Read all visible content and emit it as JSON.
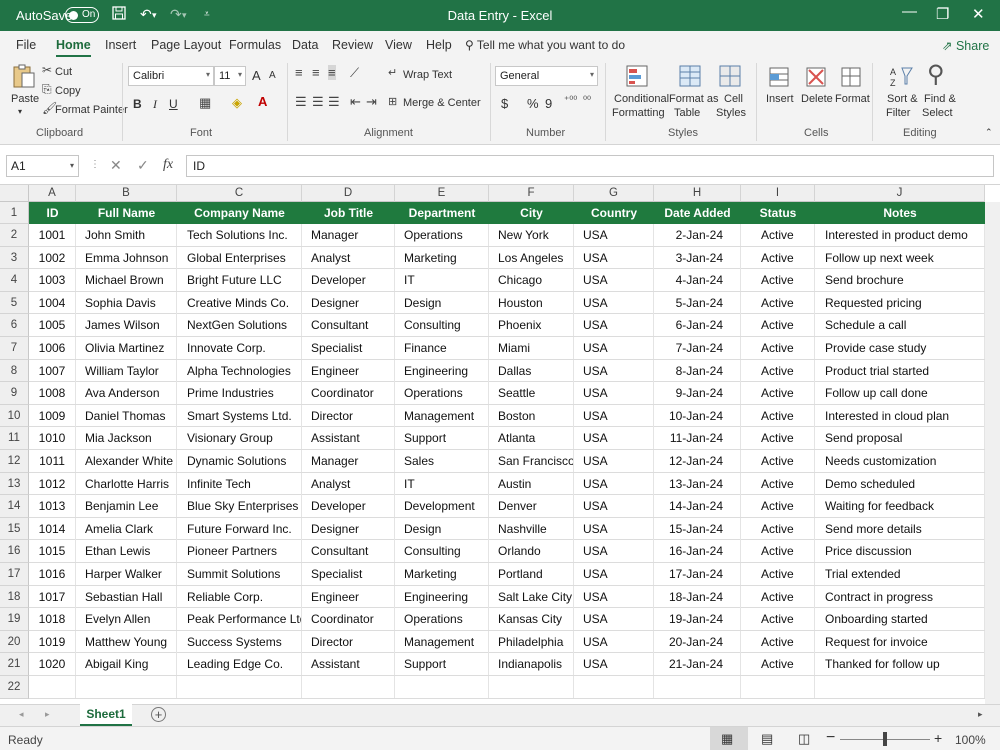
{
  "titlebar": {
    "autosave_label": "AutoSave",
    "autosave_state": "On",
    "title": "Data Entry  -  Excel"
  },
  "tabs": [
    "File",
    "Home",
    "Insert",
    "Page Layout",
    "Formulas",
    "Data",
    "Review",
    "View",
    "Help"
  ],
  "active_tab": "Home",
  "tell_me": "Tell me what you want to do",
  "share": "Share",
  "ribbon": {
    "clipboard": {
      "paste": "Paste",
      "cut": "Cut",
      "copy": "Copy",
      "format_painter": "Format Painter",
      "label": "Clipboard"
    },
    "font": {
      "name": "Calibri",
      "size": "11",
      "grow": "A",
      "shrink": "A",
      "bold": "B",
      "italic": "I",
      "underline": "U",
      "label": "Font"
    },
    "alignment": {
      "wrap_text": "Wrap Text",
      "merge_center": "Merge & Center",
      "label": "Alignment"
    },
    "number": {
      "format": "General",
      "currency": "$",
      "percent": "%",
      "comma": "9",
      "label": "Number"
    },
    "styles": {
      "conditional": "Conditional",
      "conditional2": "Formatting",
      "format_as": "Format as",
      "table": "Table",
      "cell": "Cell",
      "cell_styles": "Styles",
      "label": "Styles"
    },
    "cells": {
      "insert": "Insert",
      "delete": "Delete",
      "format": "Format",
      "label": "Cells"
    },
    "editing": {
      "sort": "Sort &",
      "filter": "Filter",
      "find": "Find &",
      "select": "Select",
      "label": "Editing"
    }
  },
  "formula_bar": {
    "name_box": "A1",
    "fx": "fx",
    "content": "ID"
  },
  "columns": [
    "A",
    "B",
    "C",
    "D",
    "E",
    "F",
    "G",
    "H",
    "I",
    "J"
  ],
  "headers": [
    "ID",
    "Full Name",
    "Company Name",
    "Job Title",
    "Department",
    "City",
    "Country",
    "Date Added",
    "Status",
    "Notes"
  ],
  "rows": [
    [
      "1001",
      "John Smith",
      "Tech Solutions Inc.",
      "Manager",
      "Operations",
      "New York",
      "USA",
      "2-Jan-24",
      "Active",
      "Interested in product demo"
    ],
    [
      "1002",
      "Emma Johnson",
      "Global Enterprises",
      "Analyst",
      "Marketing",
      "Los Angeles",
      "USA",
      "3-Jan-24",
      "Active",
      "Follow up next week"
    ],
    [
      "1003",
      "Michael Brown",
      "Bright Future LLC",
      "Developer",
      "IT",
      "Chicago",
      "USA",
      "4-Jan-24",
      "Active",
      "Send brochure"
    ],
    [
      "1004",
      "Sophia Davis",
      "Creative Minds Co.",
      "Designer",
      "Design",
      "Houston",
      "USA",
      "5-Jan-24",
      "Active",
      "Requested pricing"
    ],
    [
      "1005",
      "James Wilson",
      "NextGen Solutions",
      "Consultant",
      "Consulting",
      "Phoenix",
      "USA",
      "6-Jan-24",
      "Active",
      "Schedule a call"
    ],
    [
      "1006",
      "Olivia Martinez",
      "Innovate Corp.",
      "Specialist",
      "Finance",
      "Miami",
      "USA",
      "7-Jan-24",
      "Active",
      "Provide case study"
    ],
    [
      "1007",
      "William Taylor",
      "Alpha Technologies",
      "Engineer",
      "Engineering",
      "Dallas",
      "USA",
      "8-Jan-24",
      "Active",
      "Product trial started"
    ],
    [
      "1008",
      "Ava Anderson",
      "Prime Industries",
      "Coordinator",
      "Operations",
      "Seattle",
      "USA",
      "9-Jan-24",
      "Active",
      "Follow up call done"
    ],
    [
      "1009",
      "Daniel Thomas",
      "Smart Systems Ltd.",
      "Director",
      "Management",
      "Boston",
      "USA",
      "10-Jan-24",
      "Active",
      "Interested in cloud plan"
    ],
    [
      "1010",
      "Mia Jackson",
      "Visionary Group",
      "Assistant",
      "Support",
      "Atlanta",
      "USA",
      "11-Jan-24",
      "Active",
      "Send proposal"
    ],
    [
      "1011",
      "Alexander White",
      "Dynamic Solutions",
      "Manager",
      "Sales",
      "San Francisco",
      "USA",
      "12-Jan-24",
      "Active",
      "Needs customization"
    ],
    [
      "1012",
      "Charlotte Harris",
      "Infinite Tech",
      "Analyst",
      "IT",
      "Austin",
      "USA",
      "13-Jan-24",
      "Active",
      "Demo scheduled"
    ],
    [
      "1013",
      "Benjamin Lee",
      "Blue Sky Enterprises",
      "Developer",
      "Development",
      "Denver",
      "USA",
      "14-Jan-24",
      "Active",
      "Waiting for feedback"
    ],
    [
      "1014",
      "Amelia Clark",
      "Future Forward Inc.",
      "Designer",
      "Design",
      "Nashville",
      "USA",
      "15-Jan-24",
      "Active",
      "Send more details"
    ],
    [
      "1015",
      "Ethan Lewis",
      "Pioneer Partners",
      "Consultant",
      "Consulting",
      "Orlando",
      "USA",
      "16-Jan-24",
      "Active",
      "Price discussion"
    ],
    [
      "1016",
      "Harper Walker",
      "Summit Solutions",
      "Specialist",
      "Marketing",
      "Portland",
      "USA",
      "17-Jan-24",
      "Active",
      "Trial extended"
    ],
    [
      "1017",
      "Sebastian Hall",
      "Reliable Corp.",
      "Engineer",
      "Engineering",
      "Salt Lake City",
      "USA",
      "18-Jan-24",
      "Active",
      "Contract in progress"
    ],
    [
      "1018",
      "Evelyn Allen",
      "Peak Performance Ltd.",
      "Coordinator",
      "Operations",
      "Kansas City",
      "USA",
      "19-Jan-24",
      "Active",
      "Onboarding started"
    ],
    [
      "1019",
      "Matthew Young",
      "Success Systems",
      "Director",
      "Management",
      "Philadelphia",
      "USA",
      "20-Jan-24",
      "Active",
      "Request for invoice"
    ],
    [
      "1020",
      "Abigail King",
      "Leading Edge Co.",
      "Assistant",
      "Support",
      "Indianapolis",
      "USA",
      "21-Jan-24",
      "Active",
      "Thanked for follow up"
    ]
  ],
  "row_numbers": [
    "1",
    "2",
    "3",
    "4",
    "5",
    "6",
    "7",
    "8",
    "9",
    "10",
    "11",
    "12",
    "13",
    "14",
    "15",
    "16",
    "17",
    "18",
    "19",
    "20",
    "21",
    "22"
  ],
  "sheet_tab": "Sheet1",
  "status": "Ready",
  "zoom": "100%",
  "colors": {
    "accent": "#217346",
    "header_fill": "#1f7a3e"
  },
  "icons": [
    "save-icon",
    "undo-icon",
    "redo-icon",
    "search-icon",
    "share-icon"
  ]
}
